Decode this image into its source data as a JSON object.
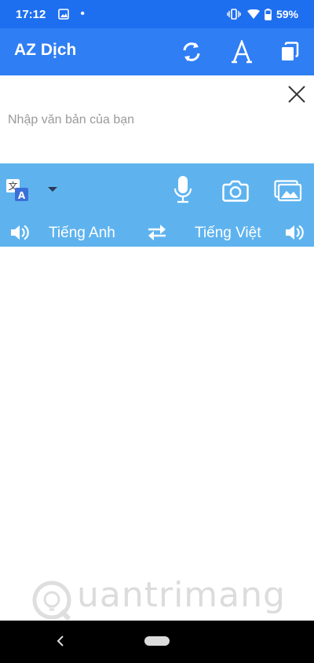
{
  "status_bar": {
    "time": "17:12",
    "dot": "•",
    "battery_percent": "59%",
    "icons": [
      "image-icon",
      "vibrate-icon",
      "wifi-icon",
      "battery-icon"
    ]
  },
  "app_bar": {
    "title": "AZ Dịch",
    "icons": [
      "refresh-icon",
      "font-icon",
      "copy-icon"
    ]
  },
  "input": {
    "placeholder": "Nhập văn bản của bạn"
  },
  "tools": {
    "icons": [
      "translate-icon",
      "dropdown-icon",
      "microphone-icon",
      "camera-icon",
      "gallery-icon"
    ]
  },
  "languages": {
    "source": "Tiếng Anh",
    "target": "Tiếng Việt"
  },
  "watermark": {
    "text": "uantrimang"
  },
  "colors": {
    "status_bar": "#1e6ff0",
    "app_bar": "#2f7ef4",
    "tool_panel": "#5eb3ef",
    "placeholder": "#9a9a9a"
  }
}
